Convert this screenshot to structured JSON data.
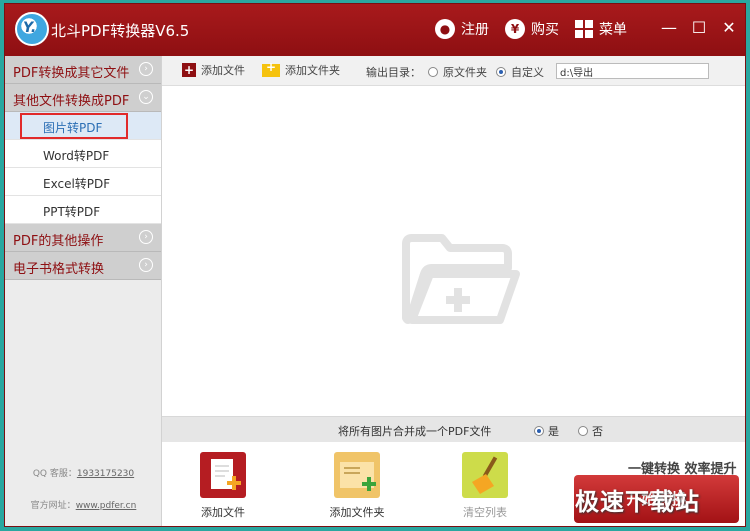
{
  "app": {
    "title": "北斗PDF转换器V6.5",
    "logo_text": "Y."
  },
  "header": {
    "register_label": "注册",
    "buy_label": "购买",
    "menu_label": "菜单",
    "min_label": "—",
    "max_label": "☐",
    "close_label": "✕"
  },
  "sidebar": {
    "categories": [
      {
        "label": "PDF转换成其它文件"
      },
      {
        "label": "其他文件转换成PDF"
      },
      {
        "label": "PDF的其他操作"
      },
      {
        "label": "电子书格式转换"
      }
    ],
    "items": [
      {
        "label": "图片转PDF"
      },
      {
        "label": "Word转PDF"
      },
      {
        "label": "Excel转PDF"
      },
      {
        "label": "PPT转PDF"
      }
    ],
    "qq_label": "QQ 客服：",
    "qq_number": "1933175230",
    "website_label": "官方网址：",
    "website": "www.pdfer.cn"
  },
  "toolbar": {
    "add_file": "添加文件",
    "add_folder": "添加文件夹",
    "output_dir_label": "输出目录：",
    "opt_original": "原文件夹",
    "opt_custom": "自定义",
    "path_value": "d:\\导出"
  },
  "merge": {
    "label": "将所有图片合并成一个PDF文件",
    "yes": "是",
    "no": "否"
  },
  "bottom": {
    "add_file": "添加文件",
    "add_folder": "添加文件夹",
    "clear_list": "清空列表",
    "slogan": "一键转换  效率提升",
    "start": "开始转换"
  },
  "watermark": "极速下载站",
  "colors": {
    "brand": "#8e0f12",
    "accent": "#2c6fb5",
    "folder": "#f5c20e"
  }
}
